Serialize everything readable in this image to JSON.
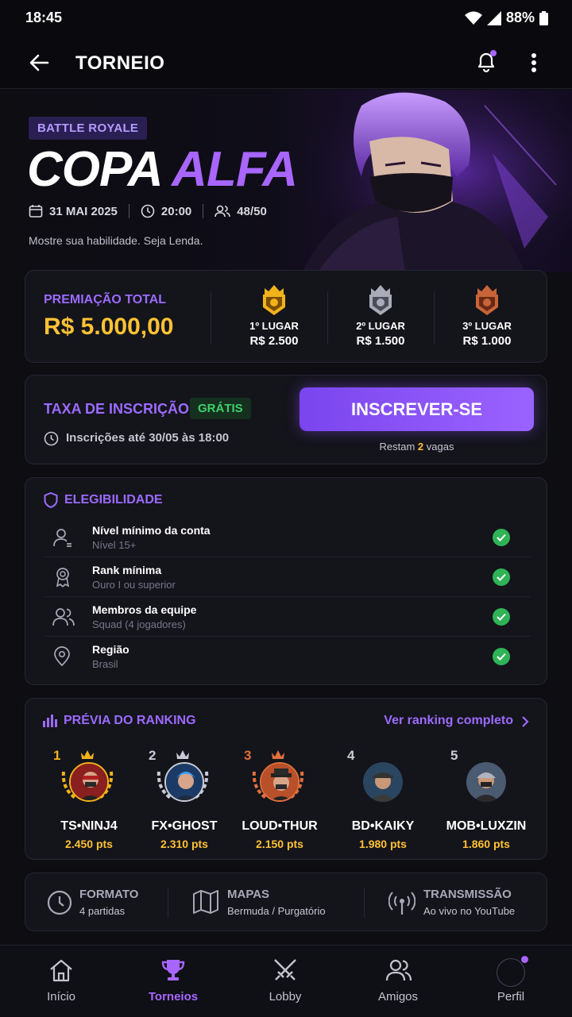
{
  "status": {
    "time": "18:45",
    "battery": "88%"
  },
  "appbar": {
    "title": "TORNEIO"
  },
  "hero": {
    "badge": "BATTLE ROYALE",
    "title_white": "COPA",
    "title_purple": "ALFA",
    "date": "31 MAI 2025",
    "time": "20:00",
    "slots": "48/50",
    "subtitle": "Mostre sua habilidade. Seja Lenda."
  },
  "prize": {
    "label": "PREMIAÇÃO TOTAL",
    "total": "R$ 5.000,00",
    "places": [
      {
        "place": "1º LUGAR",
        "amount": "R$ 2.500",
        "color": "#f2b21a"
      },
      {
        "place": "2º LUGAR",
        "amount": "R$ 1.500",
        "color": "#a9acb8"
      },
      {
        "place": "3º LUGAR",
        "amount": "R$ 1.000",
        "color": "#c8643a"
      }
    ]
  },
  "registration": {
    "fee_label": "TAXA DE INSCRIÇÃO",
    "fee_value": "GRÁTIS",
    "deadline": "Inscrições até 30/05 às 18:00",
    "button": "INSCREVER-SE",
    "remaining_prefix": "Restam",
    "remaining_count": "2",
    "remaining_suffix": "vagas"
  },
  "eligibility": {
    "title": "ELEGIBILIDADE",
    "items": [
      {
        "title": "Nível mínimo da conta",
        "detail": "Nível 15+",
        "icon": "user-level-icon"
      },
      {
        "title": "Rank mínima",
        "detail": "Ouro I ou superior",
        "icon": "rank-medal-icon"
      },
      {
        "title": "Membros da equipe",
        "detail": "Squad (4 jogadores)",
        "icon": "team-icon"
      },
      {
        "title": "Região",
        "detail": "Brasil",
        "icon": "location-pin-icon"
      }
    ]
  },
  "ranking": {
    "title": "PRÉVIA DO RANKING",
    "link": "Ver ranking completo",
    "players": [
      {
        "pos": "1",
        "name": "TS•NINJ4",
        "pts": "2.450 pts",
        "pos_color": "#f2b21a"
      },
      {
        "pos": "2",
        "name": "FX•GHOST",
        "pts": "2.310 pts",
        "pos_color": "#c9cbd6"
      },
      {
        "pos": "3",
        "name": "LOUD•THUR",
        "pts": "2.150 pts",
        "pos_color": "#e0703c"
      },
      {
        "pos": "4",
        "name": "BD•KAIKY",
        "pts": "1.980 pts",
        "pos_color": "#c9cbd6"
      },
      {
        "pos": "5",
        "name": "MOB•LUXZIN",
        "pts": "1.860 pts",
        "pos_color": "#c9cbd6"
      }
    ]
  },
  "info": {
    "format_label": "FORMATO",
    "format_value": "4 partidas",
    "maps_label": "MAPAS",
    "maps_value": "Bermuda / Purgatório",
    "stream_label": "TRANSMISSÃO",
    "stream_value": "Ao vivo no YouTube"
  },
  "nav": {
    "items": [
      {
        "label": "Início"
      },
      {
        "label": "Torneios"
      },
      {
        "label": "Lobby"
      },
      {
        "label": "Amigos"
      },
      {
        "label": "Perfil"
      }
    ]
  }
}
